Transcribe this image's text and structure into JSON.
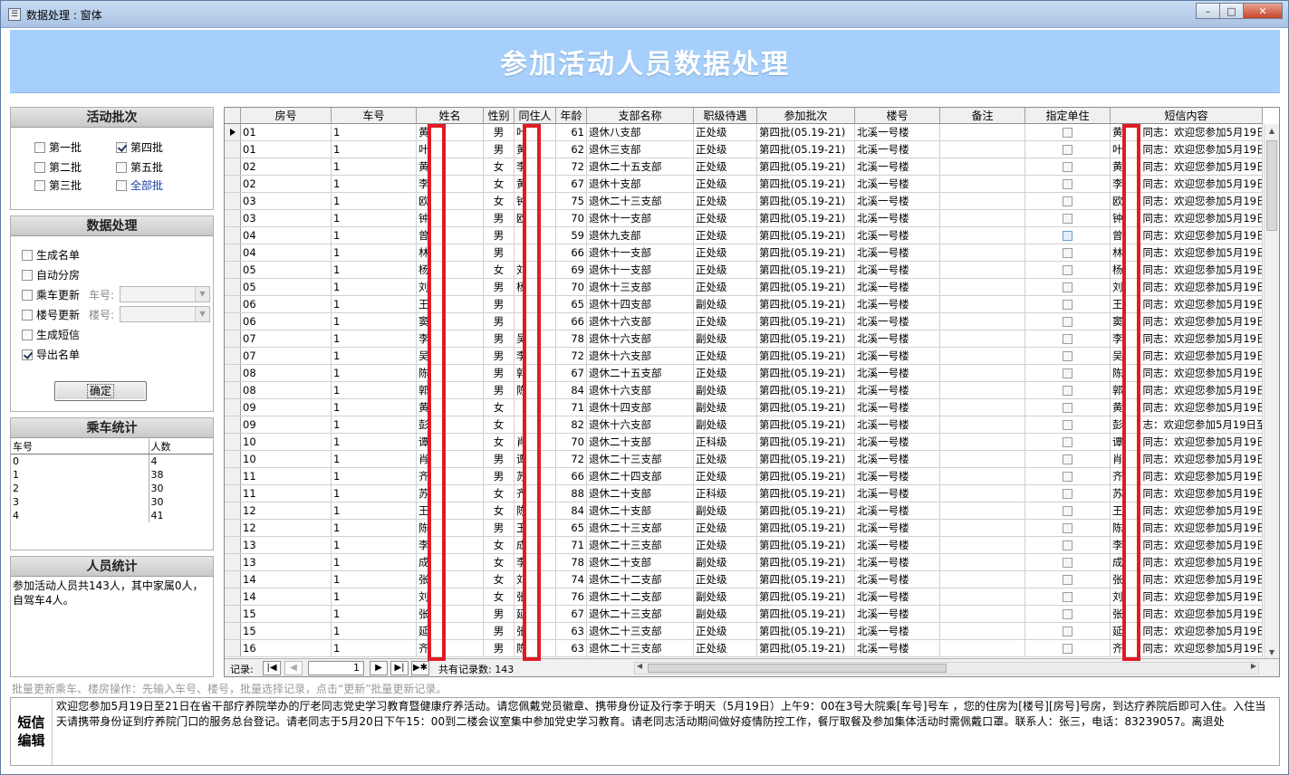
{
  "window": {
    "title": "数据处理 : 窗体",
    "min": "–",
    "max": "□",
    "close": "✕"
  },
  "banner": {
    "title": "参加活动人员数据处理"
  },
  "batch": {
    "header": "活动批次",
    "items": [
      {
        "label": "第一批",
        "checked": false
      },
      {
        "label": "第二批",
        "checked": false
      },
      {
        "label": "第三批",
        "checked": false
      },
      {
        "label": "第四批",
        "checked": true
      },
      {
        "label": "第五批",
        "checked": false
      },
      {
        "label": "全部批",
        "checked": false
      }
    ]
  },
  "process": {
    "header": "数据处理",
    "items": [
      {
        "label": "生成名单",
        "checked": false
      },
      {
        "label": "自动分房",
        "checked": false
      },
      {
        "label": "乘车更新",
        "checked": false
      },
      {
        "label": "楼号更新",
        "checked": false
      },
      {
        "label": "生成短信",
        "checked": false
      },
      {
        "label": "导出名单",
        "checked": true
      }
    ],
    "car_label": "车号:",
    "building_label": "楼号:",
    "ok": "确定"
  },
  "car_stats": {
    "header": "乘车统计",
    "col1": "车号",
    "col2": "人数",
    "rows": [
      [
        "0",
        "4"
      ],
      [
        "1",
        "38"
      ],
      [
        "2",
        "30"
      ],
      [
        "3",
        "30"
      ],
      [
        "4",
        "41"
      ]
    ]
  },
  "person_stats": {
    "header": "人员统计",
    "text": "参加活动人员共143人，其中家属0人，自驾车4人。"
  },
  "grid": {
    "columns": [
      "房号",
      "车号",
      "姓名",
      "性别",
      "同住人",
      "年龄",
      "支部名称",
      "职级待遇",
      "参加批次",
      "楼号",
      "备注",
      "指定单住",
      "短信内容"
    ],
    "rows": [
      [
        "01",
        "1",
        "黄",
        "男",
        "叶",
        "61",
        "退休八支部",
        "正处级",
        "第四批(05.19-21)",
        "北溪一号楼",
        "",
        "",
        "黄",
        "同志：欢迎您参加5月19日"
      ],
      [
        "01",
        "1",
        "叶",
        "男",
        "黄",
        "62",
        "退休三支部",
        "正处级",
        "第四批(05.19-21)",
        "北溪一号楼",
        "",
        "",
        "叶",
        "同志：欢迎您参加5月19日"
      ],
      [
        "02",
        "1",
        "黄",
        "女",
        "李",
        "72",
        "退休二十五支部",
        "正处级",
        "第四批(05.19-21)",
        "北溪一号楼",
        "",
        "",
        "黄",
        "同志：欢迎您参加5月19日"
      ],
      [
        "02",
        "1",
        "李",
        "女",
        "黄",
        "67",
        "退休十支部",
        "正处级",
        "第四批(05.19-21)",
        "北溪一号楼",
        "",
        "",
        "李",
        "同志：欢迎您参加5月19日"
      ],
      [
        "03",
        "1",
        "欧",
        "女",
        "钟",
        "75",
        "退休二十三支部",
        "正处级",
        "第四批(05.19-21)",
        "北溪一号楼",
        "",
        "",
        "欧",
        "同志：欢迎您参加5月19日"
      ],
      [
        "03",
        "1",
        "钟",
        "男",
        "欧",
        "70",
        "退休十一支部",
        "正处级",
        "第四批(05.19-21)",
        "北溪一号楼",
        "",
        "",
        "钟",
        "同志：欢迎您参加5月19日"
      ],
      [
        "04",
        "1",
        "曾",
        "男",
        "",
        "59",
        "退休九支部",
        "正处级",
        "第四批(05.19-21)",
        "北溪一号楼",
        "",
        "blue",
        "曾",
        "同志：欢迎您参加5月19日"
      ],
      [
        "04",
        "1",
        "林",
        "男",
        "",
        "66",
        "退休十一支部",
        "正处级",
        "第四批(05.19-21)",
        "北溪一号楼",
        "",
        "",
        "林",
        "同志：欢迎您参加5月19日"
      ],
      [
        "05",
        "1",
        "杨",
        "女",
        "刘",
        "69",
        "退休十一支部",
        "正处级",
        "第四批(05.19-21)",
        "北溪一号楼",
        "",
        "",
        "杨",
        "同志：欢迎您参加5月19日"
      ],
      [
        "05",
        "1",
        "刘",
        "男",
        "杨",
        "70",
        "退休十三支部",
        "正处级",
        "第四批(05.19-21)",
        "北溪一号楼",
        "",
        "",
        "刘",
        "同志：欢迎您参加5月19日"
      ],
      [
        "06",
        "1",
        "王",
        "男",
        "",
        "65",
        "退休十四支部",
        "副处级",
        "第四批(05.19-21)",
        "北溪一号楼",
        "",
        "",
        "王",
        "同志：欢迎您参加5月19日"
      ],
      [
        "06",
        "1",
        "窦",
        "男",
        "",
        "66",
        "退休十六支部",
        "正处级",
        "第四批(05.19-21)",
        "北溪一号楼",
        "",
        "",
        "窦",
        "同志：欢迎您参加5月19日"
      ],
      [
        "07",
        "1",
        "李",
        "男",
        "吴",
        "78",
        "退休十六支部",
        "副处级",
        "第四批(05.19-21)",
        "北溪一号楼",
        "",
        "",
        "李",
        "同志：欢迎您参加5月19日"
      ],
      [
        "07",
        "1",
        "吴",
        "男",
        "李",
        "72",
        "退休十六支部",
        "正处级",
        "第四批(05.19-21)",
        "北溪一号楼",
        "",
        "",
        "吴",
        "同志：欢迎您参加5月19日"
      ],
      [
        "08",
        "1",
        "陈",
        "男",
        "郭",
        "67",
        "退休二十五支部",
        "正处级",
        "第四批(05.19-21)",
        "北溪一号楼",
        "",
        "",
        "陈",
        "同志：欢迎您参加5月19日"
      ],
      [
        "08",
        "1",
        "郭",
        "男",
        "陈",
        "84",
        "退休十六支部",
        "副处级",
        "第四批(05.19-21)",
        "北溪一号楼",
        "",
        "",
        "郭",
        "同志：欢迎您参加5月19日"
      ],
      [
        "09",
        "1",
        "黄",
        "女",
        "",
        "71",
        "退休十四支部",
        "副处级",
        "第四批(05.19-21)",
        "北溪一号楼",
        "",
        "",
        "黄",
        "同志：欢迎您参加5月19日"
      ],
      [
        "09",
        "1",
        "彭",
        "女",
        "",
        "82",
        "退休十六支部",
        "副处级",
        "第四批(05.19-21)",
        "北溪一号楼",
        "",
        "",
        "彭",
        "志：欢迎您参加5月19日至"
      ],
      [
        "10",
        "1",
        "谭",
        "女",
        "肖",
        "70",
        "退休二十支部",
        "正科级",
        "第四批(05.19-21)",
        "北溪一号楼",
        "",
        "",
        "谭",
        "同志：欢迎您参加5月19日"
      ],
      [
        "10",
        "1",
        "肖",
        "男",
        "谭",
        "72",
        "退休二十三支部",
        "正处级",
        "第四批(05.19-21)",
        "北溪一号楼",
        "",
        "",
        "肖",
        "同志：欢迎您参加5月19日"
      ],
      [
        "11",
        "1",
        "齐",
        "男",
        "苏",
        "66",
        "退休二十四支部",
        "正处级",
        "第四批(05.19-21)",
        "北溪一号楼",
        "",
        "",
        "齐",
        "同志：欢迎您参加5月19日"
      ],
      [
        "11",
        "1",
        "苏",
        "女",
        "齐",
        "88",
        "退休二十支部",
        "正科级",
        "第四批(05.19-21)",
        "北溪一号楼",
        "",
        "",
        "苏",
        "同志：欢迎您参加5月19日"
      ],
      [
        "12",
        "1",
        "王",
        "女",
        "陈",
        "84",
        "退休二十支部",
        "副处级",
        "第四批(05.19-21)",
        "北溪一号楼",
        "",
        "",
        "王",
        "同志：欢迎您参加5月19日"
      ],
      [
        "12",
        "1",
        "陈",
        "男",
        "王",
        "65",
        "退休二十三支部",
        "正处级",
        "第四批(05.19-21)",
        "北溪一号楼",
        "",
        "",
        "陈",
        "同志：欢迎您参加5月19日"
      ],
      [
        "13",
        "1",
        "李",
        "女",
        "成",
        "71",
        "退休二十三支部",
        "正处级",
        "第四批(05.19-21)",
        "北溪一号楼",
        "",
        "",
        "李",
        "同志：欢迎您参加5月19日"
      ],
      [
        "13",
        "1",
        "成",
        "女",
        "李",
        "78",
        "退休二十支部",
        "副处级",
        "第四批(05.19-21)",
        "北溪一号楼",
        "",
        "",
        "成",
        "同志：欢迎您参加5月19日"
      ],
      [
        "14",
        "1",
        "张",
        "女",
        "刘",
        "74",
        "退休二十二支部",
        "正处级",
        "第四批(05.19-21)",
        "北溪一号楼",
        "",
        "",
        "张",
        "同志：欢迎您参加5月19日"
      ],
      [
        "14",
        "1",
        "刘",
        "女",
        "张",
        "76",
        "退休二十二支部",
        "副处级",
        "第四批(05.19-21)",
        "北溪一号楼",
        "",
        "",
        "刘",
        "同志：欢迎您参加5月19日"
      ],
      [
        "15",
        "1",
        "张",
        "男",
        "延",
        "67",
        "退休二十三支部",
        "副处级",
        "第四批(05.19-21)",
        "北溪一号楼",
        "",
        "",
        "张",
        "同志：欢迎您参加5月19日"
      ],
      [
        "15",
        "1",
        "延",
        "男",
        "张",
        "63",
        "退休二十三支部",
        "正处级",
        "第四批(05.19-21)",
        "北溪一号楼",
        "",
        "",
        "延",
        "同志：欢迎您参加5月19日"
      ],
      [
        "16",
        "1",
        "齐",
        "男",
        "陈",
        "63",
        "退休二十三支部",
        "正处级",
        "第四批(05.19-21)",
        "北溪一号楼",
        "",
        "",
        "齐",
        "同志：欢迎您参加5月19日"
      ]
    ]
  },
  "nav": {
    "label": "记录:",
    "current": "1",
    "total": "共有记录数: 143",
    "first": "|◀",
    "prev": "◀",
    "next": "▶",
    "last": "▶|",
    "new": "▶✱"
  },
  "hint": "批量更新乘车、楼房操作：先输入车号、楼号，批量选择记录，点击“更新”批量更新记录。",
  "sms": {
    "label1": "短信",
    "label2": "编辑",
    "text": "欢迎您参加5月19日至21日在省干部疗养院举办的厅老同志党史学习教育暨健康疗养活动。请您佩戴党员徽章、携带身份证及行李于明天（5月19日）上午9：00在3号大院乘[车号]号车 ，您的住房为[楼号][房号]号房，到达疗养院后即可入住。入住当天请携带身份证到疗养院门口的服务总台登记。请老同志于5月20日下午15：00到二楼会议室集中参加党史学习教育。请老同志活动期间做好疫情防控工作，餐厅取餐及参加集体活动时需佩戴口罩。联系人：张三，电话：83239057。离退处"
  }
}
